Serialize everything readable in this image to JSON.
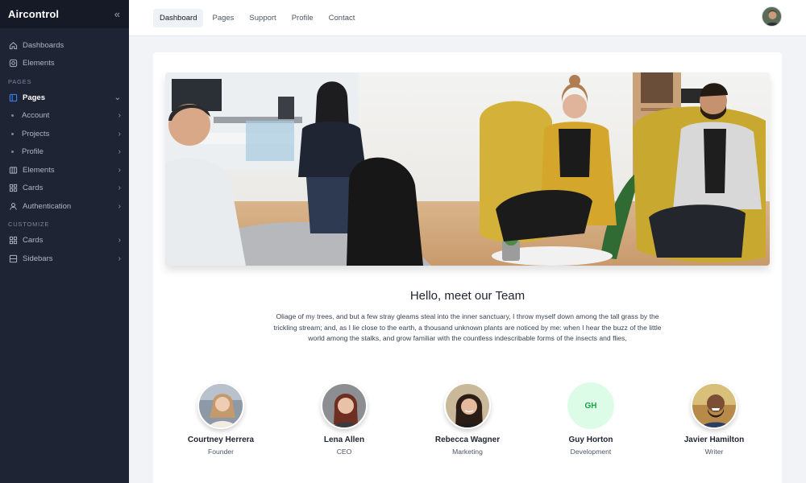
{
  "brand": {
    "name": "Aircontrol"
  },
  "sidebar": {
    "items_top": [
      {
        "label": "Dashboards",
        "icon": "home-icon"
      },
      {
        "label": "Elements",
        "icon": "settings-icon"
      }
    ],
    "pages_label": "PAGES",
    "pages": {
      "label": "Pages",
      "icon": "layout-icon"
    },
    "pages_sub": [
      {
        "label": "Account"
      },
      {
        "label": "Projects"
      },
      {
        "label": "Profile"
      }
    ],
    "items_mid": [
      {
        "label": "Elements",
        "icon": "columns-icon"
      },
      {
        "label": "Cards",
        "icon": "grid-icon"
      },
      {
        "label": "Authentication",
        "icon": "user-icon"
      }
    ],
    "customize_label": "CUSTOMIZE",
    "items_bottom": [
      {
        "label": "Cards",
        "icon": "grid-icon"
      },
      {
        "label": "Sidebars",
        "icon": "sidebar-icon"
      }
    ]
  },
  "topbar": {
    "tabs": [
      {
        "label": "Dashboard"
      },
      {
        "label": "Pages"
      },
      {
        "label": "Support"
      },
      {
        "label": "Profile"
      },
      {
        "label": "Contact"
      }
    ]
  },
  "team": {
    "title": "Hello, meet our Team",
    "description": "Oliage of my trees, and but a few stray gleams steal into the inner sanctuary, I throw myself down among the tall grass by the trickling stream; and, as I lie close to the earth, a thousand unknown plants are noticed by me: when I hear the buzz of the little world among the stalks, and grow familiar with the countless indescribable forms of the insects and flies,",
    "members": [
      {
        "name": "Courtney Herrera",
        "role": "Founder"
      },
      {
        "name": "Lena Allen",
        "role": "CEO"
      },
      {
        "name": "Rebecca Wagner",
        "role": "Marketing"
      },
      {
        "name": "Guy Horton",
        "role": "Development",
        "initials": "GH"
      },
      {
        "name": "Javier Hamilton",
        "role": "Writer"
      }
    ]
  },
  "colors": {
    "sidebar_bg": "#1e2433",
    "accent": "#3b82f6",
    "initials_bg": "#dcfce7",
    "initials_fg": "#16a34a"
  }
}
